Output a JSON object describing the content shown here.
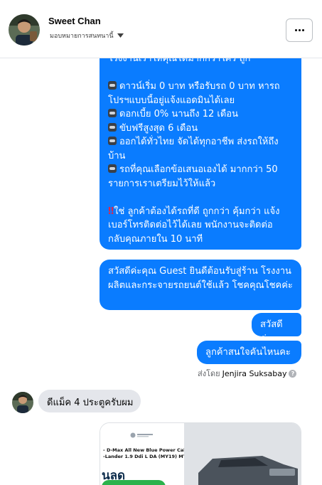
{
  "header": {
    "name": "Sweet Chan",
    "subtitle": "มอบหมายการสนทนานี้"
  },
  "messages": {
    "promo_lines": [
      "โรงงานเราให้คุณได้มากกว่าใคร ถูก",
      "",
      "ดาวน์เริ่ม 0 บาท หรือรับรถ 0 บาท หารถ",
      "โปรฯแบบนี้อยู่แจ้งแอดมินได้เลย",
      "ดอกเบี้ย 0% นานถึง 12 เดือน",
      "ขับฟรีสูงสุด 6 เดือน",
      "ออกได้ทั่วไทย จัดได้ทุกอาชีพ ส่งรถให้ถึง",
      "บ้าน",
      "รถที่คุณเลือกข้อเสนอเองได้ มากกว่า 50",
      "รายการเราเตรียมไว้ให้แล้ว",
      "",
      "ใช่ ลูกค้าต้องได้รถที่ดี ถูกกว่า คุ้มกว่า แจ้ง",
      "เบอร์โทรติดต่อไว้ได้เลย พนักงานจะติดต่อ",
      "กลับคุณภายใน 10 นาที"
    ],
    "greeting": "สวัสดีค่ะคุณ Guest ยินดีต้อนรับสู่ร้าน โรงงานผลิตและกระจายรถยนต์ใช้แล้ว โชคคุณโชคค่ะ",
    "hello": "สวัสดีค่ะ",
    "ask": "ลูกค้าสนใจคันไหนคะ",
    "sent_by_prefix": "ส่งโดย",
    "sent_by_name": "Jenjira Suksabay",
    "incoming": "ดีแม็ค 4 ประตูครับผม"
  },
  "card": {
    "model_line1": "- D-Max All New Blue Power Cab-4",
    "model_line2": "-Lander 1.9 Ddi L DA (MY19) MT",
    "promo_word": "นลด"
  },
  "colors": {
    "outgoing_bubble": "#0a7cff",
    "incoming_bubble": "#e4e6eb",
    "accent_mark": "#e0264a"
  },
  "icons": {
    "car": "car-icon",
    "mark": "double-exclamation-icon",
    "chevron": "chevron-down-icon",
    "more": "more-icon",
    "info": "info-icon"
  }
}
